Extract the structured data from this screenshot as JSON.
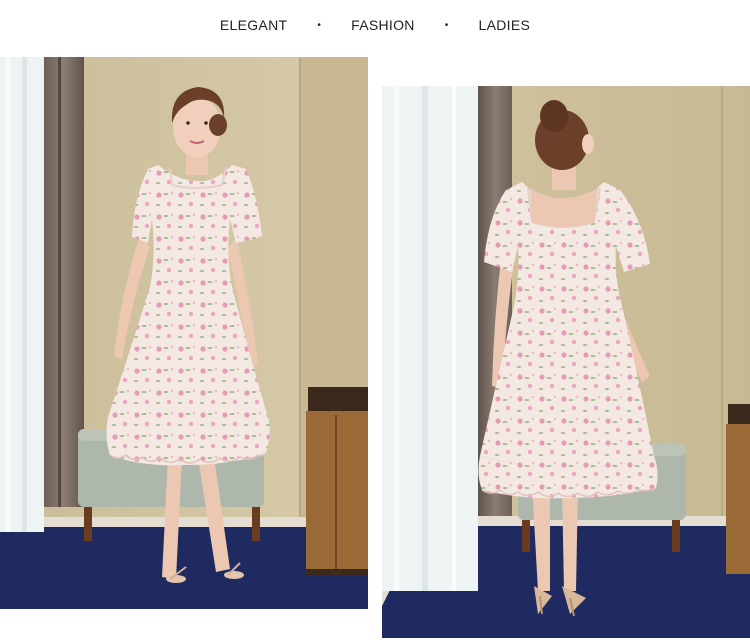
{
  "tagline": {
    "words": [
      "ELEGANT",
      "FASHION",
      "LADIES"
    ],
    "separator": "•"
  },
  "photos": [
    {
      "view": "front",
      "pose": "standing facing camera"
    },
    {
      "view": "back",
      "pose": "standing facing away"
    }
  ],
  "colors": {
    "wall": "#cdbf9c",
    "curtain_sheer": "#eef2f3",
    "curtain_drape": "#7d6f66",
    "rug": "#1e2a5e",
    "floor": "#e6e0d5",
    "ottoman": "#aeb6aa",
    "cabinet": "#8a5a2b",
    "dress": "#f3e6e2",
    "flower_pink": "#e59bb5",
    "leaf_green": "#9fb48a",
    "skin": "#eac7b2",
    "hair": "#6b3f2a"
  }
}
